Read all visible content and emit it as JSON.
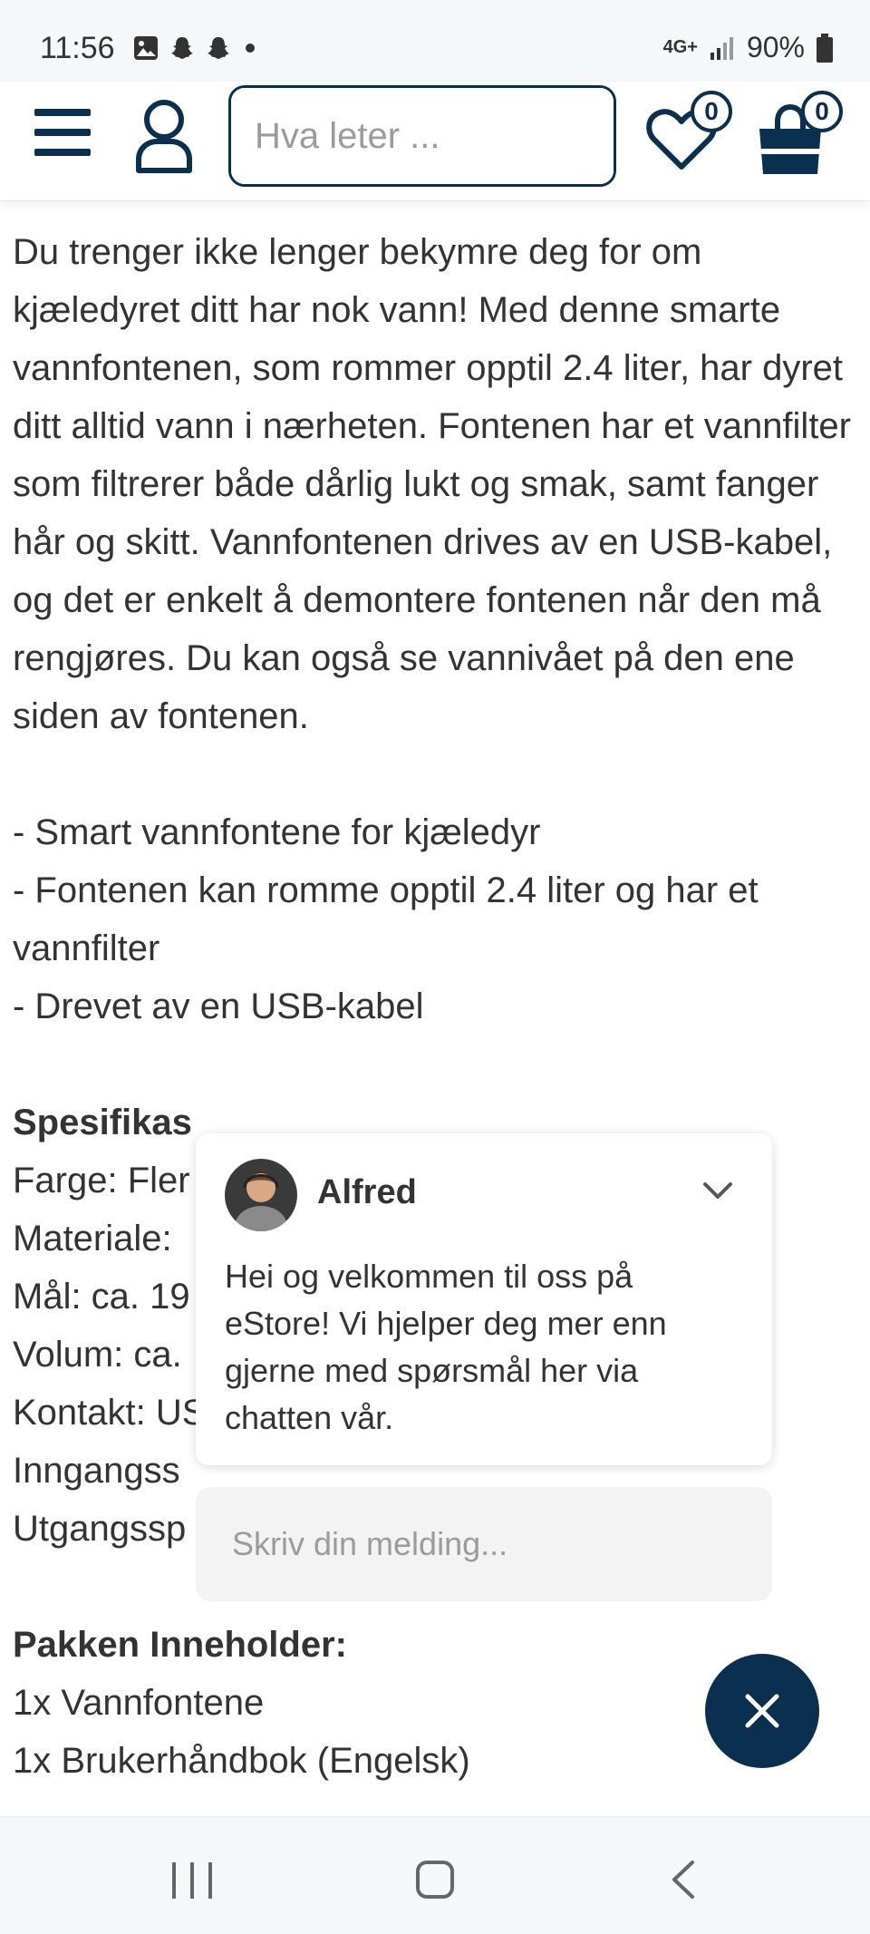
{
  "status_bar": {
    "time": "11:56",
    "network": "4G+",
    "battery": "90%"
  },
  "header": {
    "search_placeholder": "Hva leter ...",
    "wishlist_count": "0",
    "cart_count": "0"
  },
  "description": {
    "paragraph": "Du trenger ikke lenger bekymre deg for om kjæledyret ditt har nok vann! Med denne smarte vannfontenen, som rommer opptil 2.4 liter, har dyret ditt alltid vann i nærheten. Fontenen har et vannfilter som filtrerer både dårlig lukt og smak, samt fanger hår og skitt. Vannfontenen drives av en USB-kabel, og det er enkelt å demontere fontenen når den må rengjøres. Du kan også se vannivået på den ene siden av fontenen.",
    "bullets": [
      "- Smart vannfontene for kjæledyr",
      "- Fontenen kan romme opptil 2.4 liter og har et vannfilter",
      "- Drevet av en USB-kabel"
    ],
    "spec_heading": "Spesifikas",
    "specs": [
      "Farge: Fler",
      "Materiale:",
      "Mål: ca. 19",
      "Volum: ca.",
      "Kontakt: USB",
      "Inngangss",
      "Utgangssp"
    ],
    "package_heading": "Pakken Inneholder:",
    "package_items": [
      "1x Vannfontene",
      "1x Brukerhåndbok (Engelsk)"
    ]
  },
  "chat": {
    "agent_name": "Alfred",
    "message": "Hei og velkommen til oss på eStore! Vi hjelper deg mer enn gjerne med spørsmål her via chatten vår.",
    "input_placeholder": "Skriv din melding..."
  },
  "colors": {
    "brand": "#0b2f4f",
    "text": "#333333"
  }
}
